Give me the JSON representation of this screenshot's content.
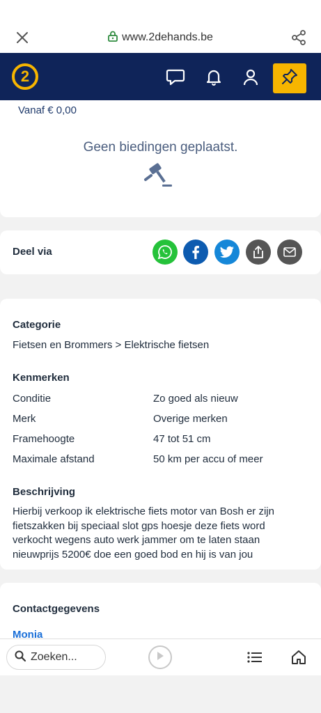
{
  "browser": {
    "url": "www.2dehands.be"
  },
  "header": {
    "logo": "2"
  },
  "bids": {
    "price_from": "Vanaf € 0,00",
    "empty_message": "Geen biedingen geplaatst."
  },
  "share": {
    "label": "Deel via",
    "channels": [
      "whatsapp-icon",
      "facebook-icon",
      "twitter-icon",
      "upload-icon",
      "mail-icon"
    ]
  },
  "details": {
    "category_title": "Categorie",
    "category_value": "Fietsen en Brommers > Elektrische fietsen",
    "features_title": "Kenmerken",
    "attributes": [
      {
        "name": "Conditie",
        "value": "Zo goed als nieuw"
      },
      {
        "name": "Merk",
        "value": "Overige merken"
      },
      {
        "name": "Framehoogte",
        "value": "47 tot 51 cm"
      },
      {
        "name": "Maximale afstand",
        "value": "50 km per accu of meer"
      }
    ],
    "description_title": "Beschrijving",
    "description": "Hierbij verkoop ik elektrische fiets motor van Bosh er zijn fietszakken bij speciaal slot gps hoesje deze fiets word verkocht wegens auto werk jammer om te laten staan nieuwprijs 5200€ doe een goed bod en hij is van jou"
  },
  "contact": {
    "title": "Contactgegevens",
    "name": "Monia"
  },
  "bottom": {
    "search_placeholder": "Zoeken..."
  },
  "colors": {
    "brand_navy": "#0f2459",
    "brand_yellow": "#f7b500",
    "link_blue": "#1a6fd8"
  }
}
